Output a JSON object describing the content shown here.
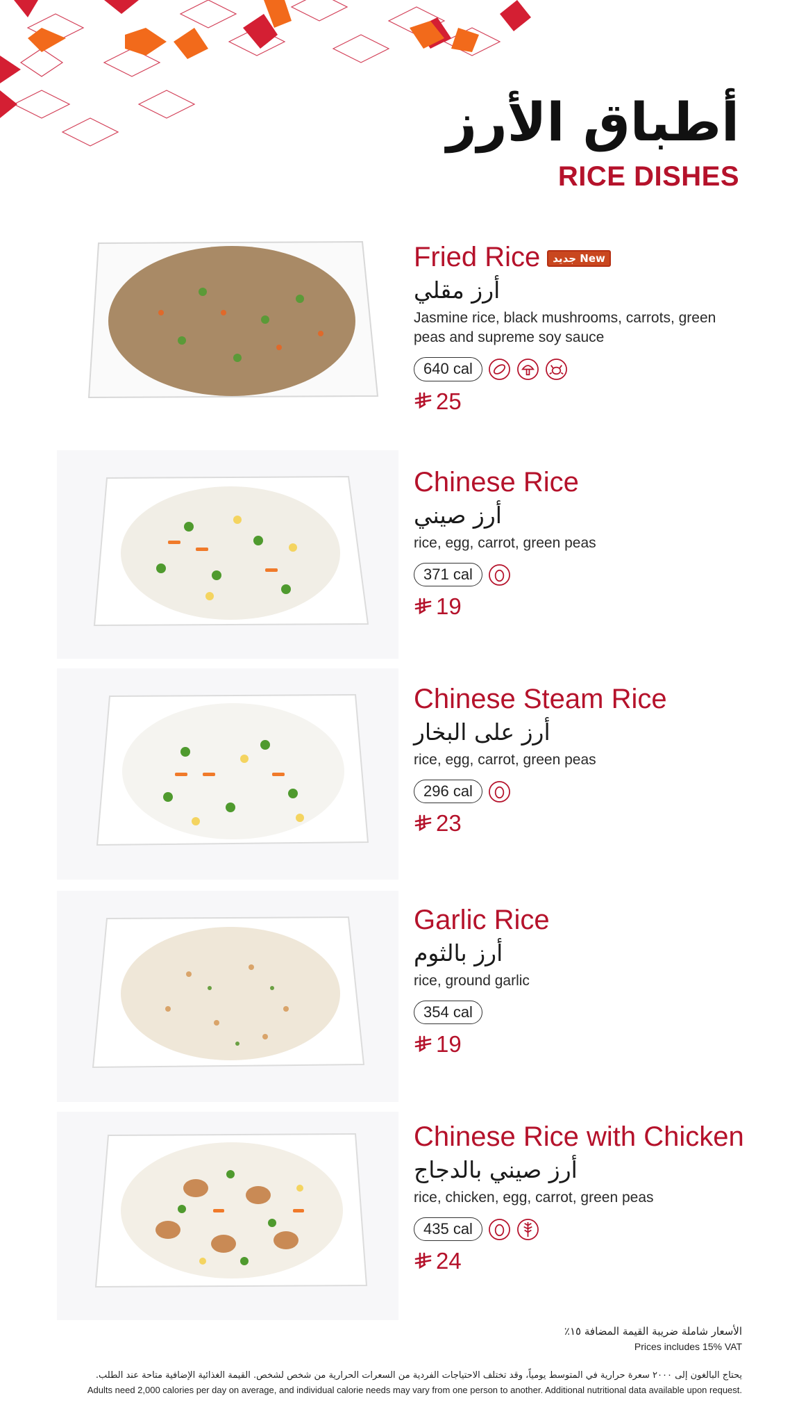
{
  "header": {
    "title_ar": "أطباق الأرز",
    "title_en": "RICE DISHES"
  },
  "colors": {
    "brand_red": "#b5122b",
    "accent_orange": "#f26a1b",
    "crimson": "#d41f33"
  },
  "items": [
    {
      "name_en": "Fried Rice",
      "badge": "جديد New",
      "name_ar": "أرز مقلي",
      "description": "Jasmine rice, black mushrooms, carrots, green peas and supreme soy sauce",
      "calories": "640 cal",
      "allergens": [
        "soy-icon",
        "mushroom-icon",
        "shellfish-icon"
      ],
      "price": "25",
      "currency": "riyal-symbol-icon"
    },
    {
      "name_en": "Chinese Rice",
      "name_ar": "أرز صيني",
      "description": "rice, egg, carrot, green peas",
      "calories": "371 cal",
      "allergens": [
        "egg-icon"
      ],
      "price": "19",
      "currency": "riyal-symbol-icon"
    },
    {
      "name_en": "Chinese Steam Rice",
      "name_ar": "أرز على البخار",
      "description": "rice, egg, carrot, green peas",
      "calories": "296 cal",
      "allergens": [
        "egg-icon"
      ],
      "price": "23",
      "currency": "riyal-symbol-icon"
    },
    {
      "name_en": "Garlic Rice",
      "name_ar": "أرز بالثوم",
      "description": "rice, ground garlic",
      "calories": "354 cal",
      "allergens": [],
      "price": "19",
      "currency": "riyal-symbol-icon"
    },
    {
      "name_en": "Chinese Rice with Chicken",
      "name_ar": "أرز صيني بالدجاج",
      "description": "rice, chicken, egg, carrot, green peas",
      "calories": "435 cal",
      "allergens": [
        "egg-icon",
        "celery-icon"
      ],
      "price": "24",
      "currency": "riyal-symbol-icon"
    }
  ],
  "footer": {
    "vat_ar": "الأسعار شاملة ضريبة القيمة المضافة ١٥٪",
    "vat_en": "Prices includes 15% VAT",
    "note_ar": "يحتاج البالغون إلى ٢٠٠٠ سعرة حرارية في المتوسط يومياً، وقد تختلف الاحتياجات الفردية من السعرات الحرارية من شخص لشخص. القيمة الغذائية الإضافية متاحة عند الطلب.",
    "note_en": "Adults need 2,000 calories per day on average, and individual calorie needs may vary from one person to another. Additional nutritional data available upon request."
  }
}
